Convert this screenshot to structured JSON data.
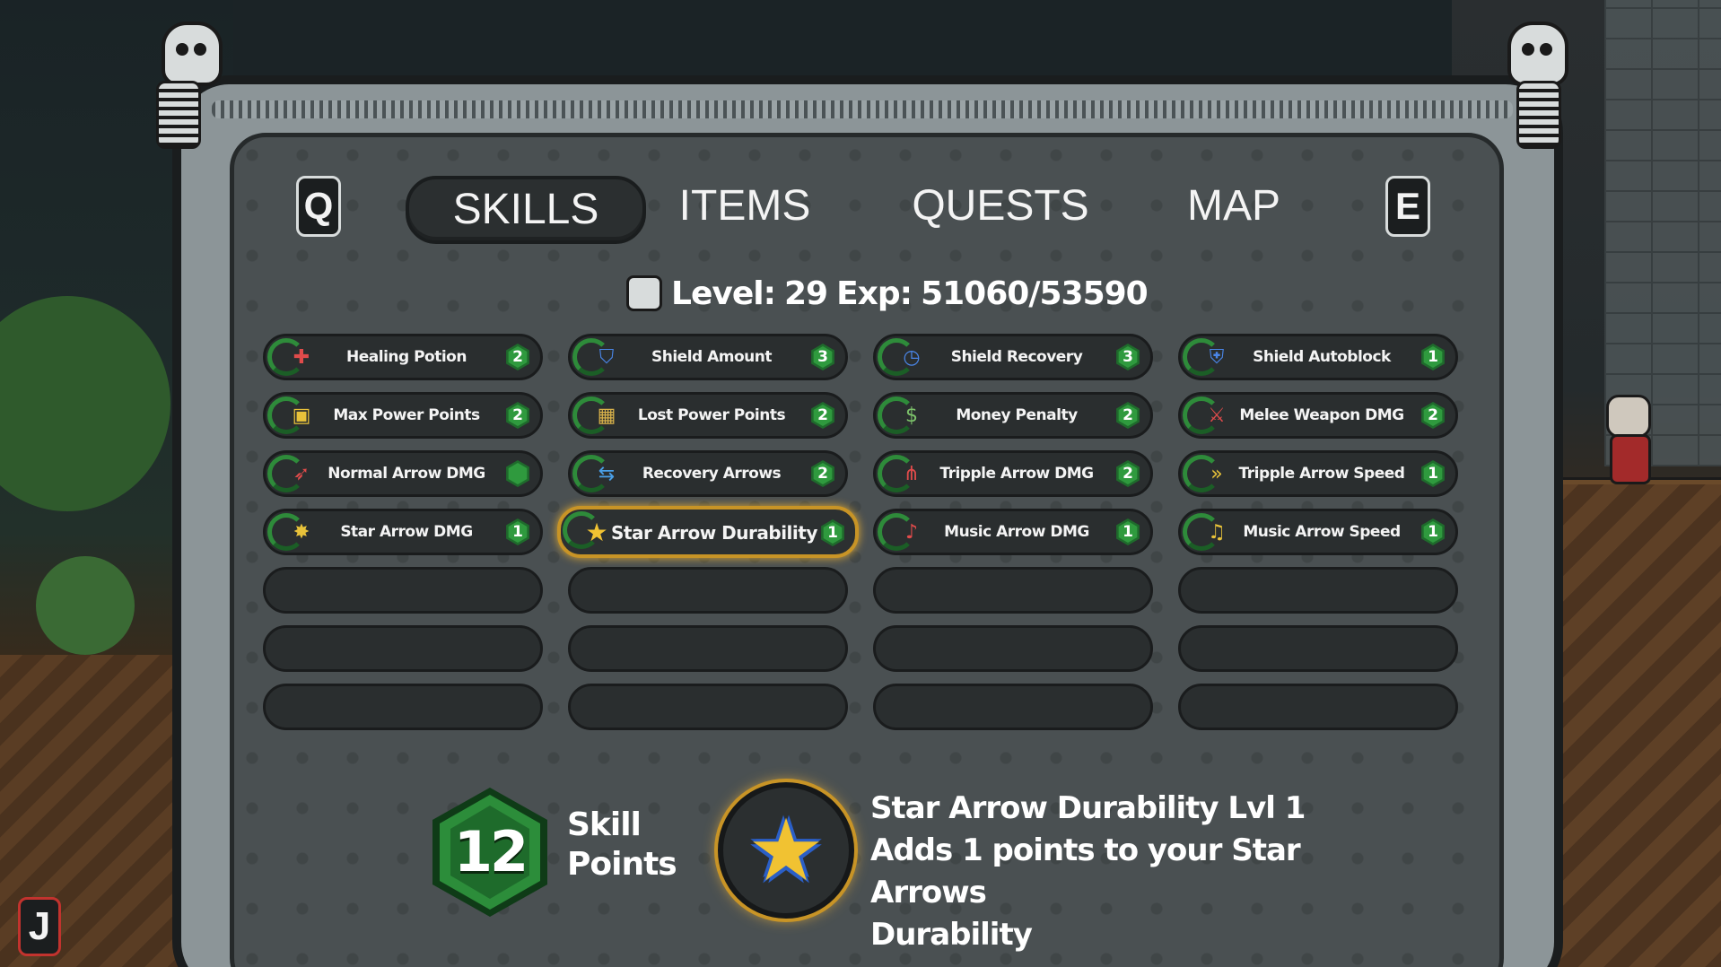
{
  "tabs": {
    "prev_key": "Q",
    "next_key": "E",
    "items": [
      {
        "label": "SKILLS",
        "active": true
      },
      {
        "label": "ITEMS",
        "active": false
      },
      {
        "label": "QUESTS",
        "active": false
      },
      {
        "label": "MAP",
        "active": false
      }
    ]
  },
  "status": {
    "level_label": "Level:",
    "level": "29",
    "exp_label": "Exp:",
    "exp": "51060/53590"
  },
  "skills": [
    [
      {
        "name": "Healing Potion",
        "level": "2",
        "icon": "healing-potion-icon"
      },
      {
        "name": "Max Power Points",
        "level": "2",
        "icon": "max-power-icon"
      },
      {
        "name": "Normal Arrow DMG",
        "level": "",
        "icon": "normal-arrow-icon"
      },
      {
        "name": "Star Arrow DMG",
        "level": "1",
        "icon": "star-arrow-icon"
      }
    ],
    [
      {
        "name": "Shield Amount",
        "level": "3",
        "icon": "shield-icon"
      },
      {
        "name": "Lost Power Points",
        "level": "2",
        "icon": "lost-power-icon"
      },
      {
        "name": "Recovery Arrows",
        "level": "2",
        "icon": "recovery-arrows-icon"
      },
      {
        "name": "Star Arrow Durability",
        "level": "1",
        "icon": "star-icon",
        "selected": true
      }
    ],
    [
      {
        "name": "Shield Recovery",
        "level": "3",
        "icon": "clock-icon"
      },
      {
        "name": "Money Penalty",
        "level": "2",
        "icon": "money-bag-icon"
      },
      {
        "name": "Tripple Arrow DMG",
        "level": "2",
        "icon": "tripple-arrow-icon"
      },
      {
        "name": "Music Arrow DMG",
        "level": "1",
        "icon": "music-arrow-icon"
      }
    ],
    [
      {
        "name": "Shield Autoblock",
        "level": "1",
        "icon": "autoblock-shield-icon"
      },
      {
        "name": "Melee Weapon DMG",
        "level": "2",
        "icon": "sword-icon"
      },
      {
        "name": "Tripple Arrow Speed",
        "level": "1",
        "icon": "tripple-arrow-speed-icon"
      },
      {
        "name": "Music Arrow Speed",
        "level": "1",
        "icon": "music-speed-icon"
      }
    ]
  ],
  "skill_points": {
    "value": "12",
    "label_line1": "Skill",
    "label_line2": "Points"
  },
  "detail": {
    "title": "Star Arrow Durability Lvl 1",
    "line1": "Adds 1 points to your Star Arrows",
    "line2": "Durability"
  },
  "journal_key": "J",
  "colors": {
    "accent_green": "#2f9a3e",
    "selected_gold": "#c89426",
    "panel": "#4a5052"
  }
}
